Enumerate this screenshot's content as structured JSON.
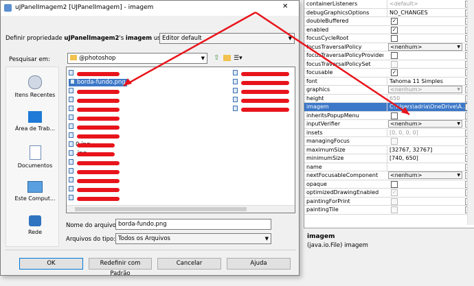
{
  "properties": [
    {
      "name": "containerListeners",
      "value": "<default>",
      "kind": "text",
      "dim": true
    },
    {
      "name": "debugGraphicsOptions",
      "value": "NO_CHANGES",
      "kind": "text"
    },
    {
      "name": "doubleBuffered",
      "kind": "check",
      "checked": true
    },
    {
      "name": "enabled",
      "kind": "check",
      "checked": true
    },
    {
      "name": "focusCycleRoot",
      "kind": "check",
      "checked": false
    },
    {
      "name": "focusTraversalPolicy",
      "value": "<nenhum>",
      "kind": "combo"
    },
    {
      "name": "focusTraversalPolicyProvider",
      "kind": "check",
      "checked": false
    },
    {
      "name": "focusTraversalPolicySet",
      "kind": "check",
      "checked": false,
      "disabled": true
    },
    {
      "name": "focusable",
      "kind": "check",
      "checked": true
    },
    {
      "name": "font",
      "value": "Tahoma 11 Simples",
      "kind": "text"
    },
    {
      "name": "graphics",
      "value": "<nenhum>",
      "kind": "combo",
      "dim": true
    },
    {
      "name": "height",
      "value": "650",
      "kind": "text",
      "dim": true
    },
    {
      "name": "imagem",
      "value": "C:\\Users\\adria\\OneDrive\\Á...",
      "kind": "text",
      "selected": true
    },
    {
      "name": "inheritsPopupMenu",
      "kind": "check",
      "checked": false
    },
    {
      "name": "inputVerifier",
      "value": "<nenhum>",
      "kind": "combo"
    },
    {
      "name": "insets",
      "value": "[0, 0, 0, 0]",
      "kind": "text",
      "dim": true
    },
    {
      "name": "managingFocus",
      "kind": "check",
      "checked": false,
      "disabled": true
    },
    {
      "name": "maximumSize",
      "value": "[32767, 32767]",
      "kind": "text"
    },
    {
      "name": "minimumSize",
      "value": "[740, 650]",
      "kind": "text"
    },
    {
      "name": "name",
      "value": "",
      "kind": "text"
    },
    {
      "name": "nextFocusableComponent",
      "value": "<nenhum>",
      "kind": "combo"
    },
    {
      "name": "opaque",
      "kind": "check",
      "checked": false
    },
    {
      "name": "optimizedDrawingEnabled",
      "kind": "check",
      "checked": true,
      "disabled": true
    },
    {
      "name": "paintingForPrint",
      "kind": "check",
      "checked": false,
      "disabled": true
    },
    {
      "name": "paintingTile",
      "kind": "check",
      "checked": false,
      "disabled": true
    }
  ],
  "description": {
    "title": "imagem",
    "text": "(java.io.File) imagem"
  },
  "dialog": {
    "title": "uJPanelImagem2 [UJPanelImagem] - imagem",
    "define_prefix": "Definir propriedade ",
    "define_bold": "uJPanelImagem2",
    "define_mid": "'s ",
    "define_bold2": "imagem",
    "define_suffix": " usando:",
    "editor": "Editor default",
    "look_in_label": "Pesquisar em:",
    "look_in_value": "@photoshop",
    "places": [
      "Itens Recentes",
      "Área de Trab...",
      "Documentos",
      "Este Comput...",
      "Rede"
    ],
    "files_col1": [
      "",
      "borda-fundo.png",
      "",
      "",
      "",
      "",
      "",
      "",
      "0.jpg",
      ".jpg",
      "",
      "",
      "",
      "",
      ""
    ],
    "files_col2": [
      "",
      "",
      "",
      "",
      ""
    ],
    "filename_label": "Nome do arquivo:",
    "filename_value": "borda-fundo.png",
    "filetype_label": "Arquivos do tipo:",
    "filetype_value": "Todos os Arquivos",
    "buttons": {
      "ok": "OK",
      "reset": "Redefinir com Padrão",
      "cancel": "Cancelar",
      "help": "Ajuda"
    },
    "window_controls": {
      "close": "✕"
    }
  },
  "colors": {
    "selection": "#3c78c8",
    "annotation": "#e8141b"
  }
}
